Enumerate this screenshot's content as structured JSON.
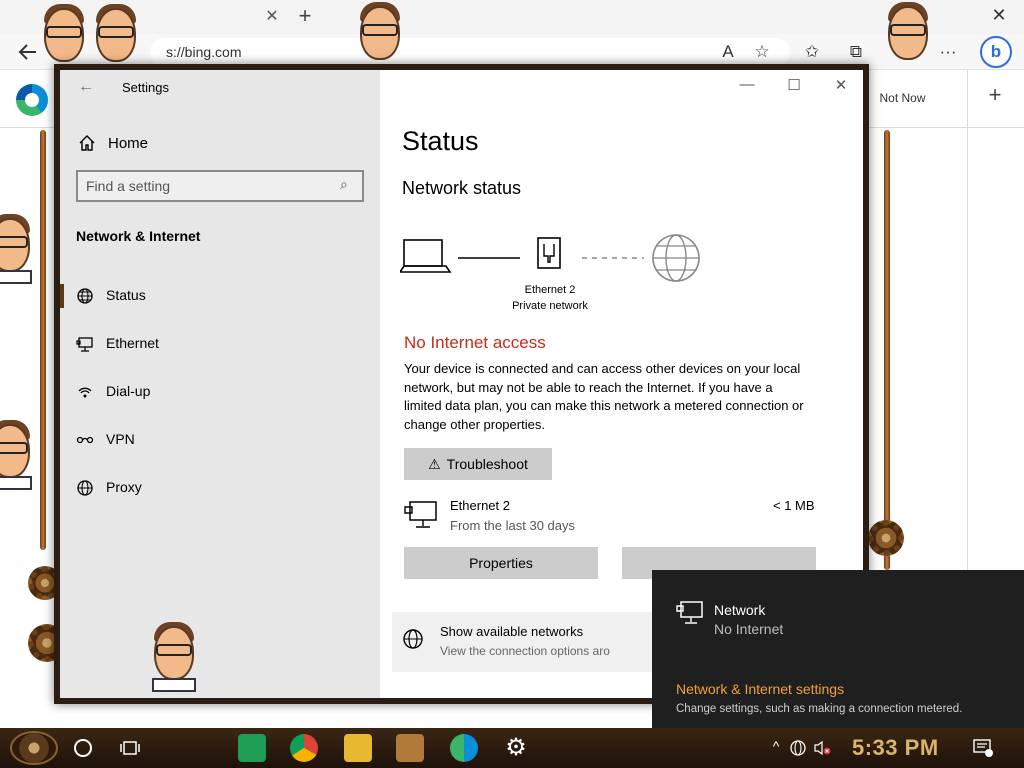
{
  "browser": {
    "address": "s://bing.com",
    "not_now": "Not Now",
    "tab_close": "✕",
    "tab_new": "+",
    "window_close": "✕",
    "bing_button": "b",
    "more": "···"
  },
  "settings": {
    "title": "Settings",
    "home": "Home",
    "search_placeholder": "Find a setting",
    "section": "Network & Internet",
    "nav": [
      {
        "label": "Status",
        "icon": "globe-status-icon"
      },
      {
        "label": "Ethernet",
        "icon": "ethernet-icon"
      },
      {
        "label": "Dial-up",
        "icon": "dialup-icon"
      },
      {
        "label": "VPN",
        "icon": "vpn-icon"
      },
      {
        "label": "Proxy",
        "icon": "globe-icon"
      }
    ],
    "page_title": "Status",
    "network_status_heading": "Network status",
    "ethernet_label": "Ethernet 2",
    "network_type": "Private network",
    "no_internet": "No Internet access",
    "description": "Your device is connected and can access other devices on your local network, but may not be able to reach the Internet. If you have a limited data plan, you can make this network a metered connection or change other properties.",
    "troubleshoot": "Troubleshoot",
    "adapter": {
      "name": "Ethernet 2",
      "period": "From the last 30 days",
      "usage": "< 1 MB"
    },
    "properties": "Properties",
    "data_usage": "",
    "show_networks": {
      "title": "Show available networks",
      "subtitle": "View the connection options aro"
    }
  },
  "flyout": {
    "title": "Network",
    "status": "No Internet",
    "link": "Network & Internet settings",
    "note": "Change settings, such as making a connection metered."
  },
  "taskbar": {
    "clock": "5:33 PM"
  },
  "colors": {
    "error_red": "#c42b1c",
    "flyout_link": "#f2a03a",
    "clock_gold": "#d9b46a"
  }
}
